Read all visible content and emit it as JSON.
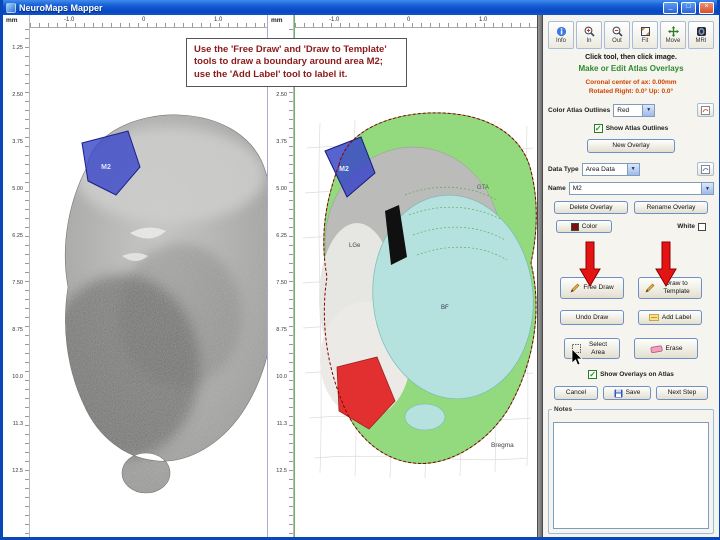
{
  "window": {
    "title": "NeuroMaps Mapper",
    "minimize": "_",
    "maximize": "□",
    "close": "×"
  },
  "instruction": {
    "text": "Use the 'Free Draw' and 'Draw to Template' tools to draw a boundary around area M2; use the 'Add Label' tool to label it."
  },
  "rulers": {
    "unit": "mm",
    "top": [
      "-1.0",
      "0",
      "1.0"
    ],
    "side": [
      "1.25",
      "2.50",
      "3.75",
      "5.00",
      "6.25",
      "7.50",
      "8.75",
      "10.0",
      "11.3",
      "12.5"
    ]
  },
  "histology": {
    "m2_label": "M2"
  },
  "atlas": {
    "m2_label": "M2",
    "gta": "GTA",
    "lge": "LGe",
    "bf": "BF",
    "bregma": "Bregma"
  },
  "sidebar": {
    "toolbar": {
      "info": "Info",
      "in": "In",
      "out": "Out",
      "fit": "Fit",
      "move": "Move",
      "mri": "MRI"
    },
    "hint": "Click tool, then click image.",
    "section_title": "Make or Edit Atlas Overlays",
    "coronal_line1": "Coronal center of ax: 0.00mm",
    "coronal_line2": "Rotated Right: 0.0°  Up: 0.0°",
    "outline_color_label": "Color Atlas Outlines",
    "outline_color_value": "Red",
    "show_outlines": "Show Atlas Outlines",
    "new_overlay": "New Overlay",
    "data_type_label": "Data Type",
    "data_type_value": "Area Data",
    "name_label": "Name",
    "name_value": "M2",
    "delete_overlay": "Delete Overlay",
    "rename_overlay": "Rename Overlay",
    "color_label": "Color",
    "white_label": "White",
    "free_draw": "Free Draw",
    "draw_to_template": "Draw to Template",
    "undo_draw": "Undo Draw",
    "add_label": "Add Label",
    "select_area": "Select Area",
    "erase": "Erase",
    "show_overlays": "Show Overlays on Atlas",
    "cancel": "Cancel",
    "save": "Save",
    "next_step": "Next Step",
    "notes": "Notes",
    "check": "✓",
    "combo_arrow": "▼"
  }
}
